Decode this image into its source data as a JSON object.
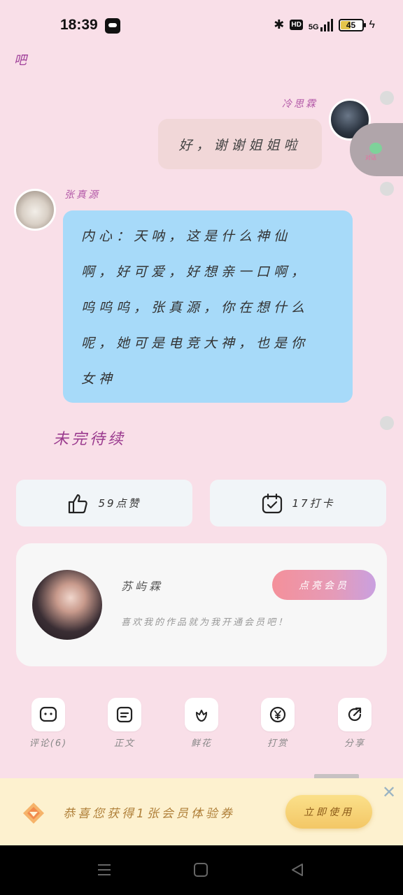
{
  "status_bar": {
    "time": "18:39",
    "bluetooth": "✱",
    "hd": "HD",
    "network": "5G",
    "battery": "45",
    "bolt": "ϟ"
  },
  "chat": {
    "prev_line": "吧",
    "right_message": {
      "sender": "冷思霖",
      "text": "好，谢谢姐姐啦"
    },
    "left_message": {
      "sender": "张真源",
      "lines": [
        "内心：天呐，这是什么神仙",
        "啊，好可爱，好想亲一口啊，",
        "呜呜呜，张真源，你在想什么",
        "呢，她可是电竞大神，也是你",
        "女神"
      ]
    },
    "to_be_continued": "未完待续"
  },
  "float_button": {
    "label": "对话"
  },
  "stats": {
    "likes": "59点赞",
    "punch": "17打卡"
  },
  "member_card": {
    "author": "苏屿霖",
    "vip_button": "点亮会员",
    "tip": "喜欢我的作品就为我开通会员吧！"
  },
  "actions": [
    {
      "label": "评论(6)",
      "icon": "comment-icon"
    },
    {
      "label": "正文",
      "icon": "document-icon"
    },
    {
      "label": "鲜花",
      "icon": "flower-icon"
    },
    {
      "label": "打赏",
      "icon": "yen-icon"
    },
    {
      "label": "分享",
      "icon": "share-icon"
    }
  ],
  "banner": {
    "message": "恭喜您获得1张会员体验券",
    "button": "立即使用",
    "close": "✕"
  },
  "colors": {
    "page_bg": "#f9dfe8",
    "left_bubble": "#a7daf9",
    "right_bubble": "#f1d7d8",
    "banner_bg": "#fdf1cf",
    "vip_gradient_start": "#f4909a",
    "vip_gradient_end": "#c9a0e0"
  }
}
